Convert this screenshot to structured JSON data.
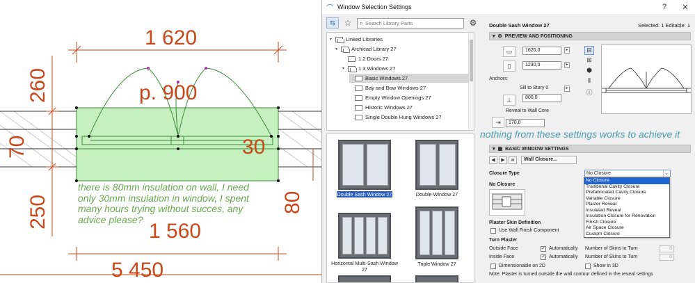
{
  "cad": {
    "dims": {
      "top_width": "1 620",
      "label_p": "p. 900",
      "left_260": "260",
      "left_70": "70",
      "left_250": "250",
      "inner_30": "30",
      "right_80": "80",
      "bottom_1560": "1 560",
      "bottom_5450": "5 450"
    },
    "note": "there is 80mm insulation on wall, I need only 30mm insulation in window, I spent many hours trying without succes, any advice please?",
    "colors": {
      "dimension": "#c8481a",
      "note": "#6aa84f",
      "window_fill": "#c6f0c0"
    }
  },
  "dialog": {
    "title": "Window Selection Settings",
    "search_placeholder": "Search Library Parts",
    "tree": [
      "Linked Libraries",
      "Archicad Library 27",
      "1.2 Doors 27",
      "1.3 Windows 27",
      "Basic Windows 27",
      "Bay and Bow Windows 27",
      "Empty Window Openings 27",
      "Historic Windows 27",
      "Single Double Hung Windows 27"
    ],
    "gallery": [
      {
        "caption": "Double Sash Window 27",
        "selected": true
      },
      {
        "caption": "Double Window 27",
        "selected": false
      },
      {
        "caption": "Horizontal Multi-Sash Window 27",
        "selected": false
      },
      {
        "caption": "Triple Window 27",
        "selected": false
      }
    ],
    "header": {
      "name": "Double Sash Window 27",
      "selected_info": "Selected: 1 Editable: 1"
    },
    "preview_section": {
      "title": "PREVIEW AND POSITIONING",
      "width": "1620,0",
      "height": "1230,0",
      "anchors_label": "Anchors:",
      "sill_label": "Sill to Story 0",
      "sill_value": "800,0",
      "reveal_label": "Reveal to Wall Core",
      "reveal_value": "170,0"
    },
    "overlay_note": "nothing from these settings works to achieve it",
    "basic_section": {
      "title": "BASIC WINDOW SETTINGS",
      "page_dropdown": "Wall Closure...",
      "closure_type_label": "Closure Type",
      "closure_type_value": "No Closure",
      "closure_options": [
        "No Closure",
        "Traditional Cavity Closure",
        "Prefabricated Cavity Closure",
        "Variable Closure",
        "Plaster Reveal",
        "Insulated Reveal",
        "Insulation Closure for Renovation",
        "Finish Closure",
        "Air Space Closure",
        "Custom Closure"
      ],
      "no_closure_heading": "No Closure",
      "plaster_skin_heading": "Plaster Skin Definition",
      "use_wall_finish": "Use Wall Finish Component",
      "turn_plaster_heading": "Turn Plaster",
      "outside_face": "Outside Face",
      "inside_face": "Inside Face",
      "automatically": "Automatically",
      "skins_label": "Number of Skins to Turn",
      "skins_value": "0",
      "dimensionable": "Dimensionable on 2D",
      "show_3d": "Show in 3D",
      "note": "Note: Plaster is turned outside the wall contour defined in the reveal settings"
    }
  }
}
